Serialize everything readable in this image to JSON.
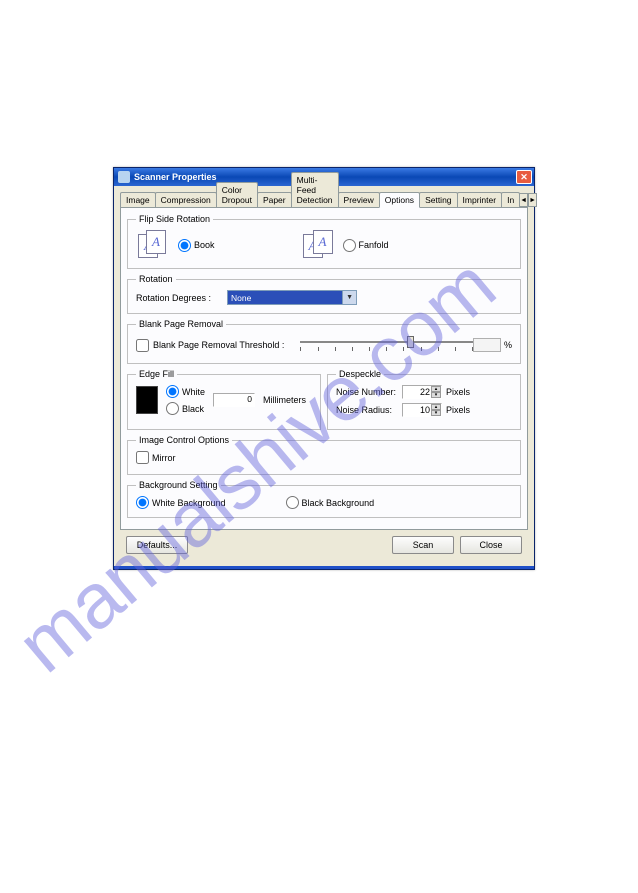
{
  "watermark": "manualshive.com",
  "window": {
    "title": "Scanner Properties"
  },
  "tabs": {
    "items": [
      "Image",
      "Compression",
      "Color Dropout",
      "Paper",
      "Multi-Feed Detection",
      "Preview",
      "Options",
      "Setting",
      "Imprinter",
      "In"
    ],
    "scroll_left": "◄",
    "scroll_right": "►"
  },
  "flip": {
    "legend": "Flip Side Rotation",
    "book": "Book",
    "fanfold": "Fanfold"
  },
  "rotation": {
    "legend": "Rotation",
    "label": "Rotation Degrees :",
    "value": "None"
  },
  "blank": {
    "legend": "Blank Page Removal",
    "label": "Blank Page Removal Threshold :",
    "value": "",
    "pct": "%"
  },
  "edgefill": {
    "legend": "Edge Fill",
    "white": "White",
    "black": "Black",
    "value": "0",
    "unit": "Millimeters"
  },
  "despeckle": {
    "legend": "Despeckle",
    "noise_number_label": "Noise Number:",
    "noise_number": "22",
    "noise_radius_label": "Noise Radius:",
    "noise_radius": "10",
    "unit": "Pixels"
  },
  "imgctrl": {
    "legend": "Image Control Options",
    "mirror": "Mirror"
  },
  "bg": {
    "legend": "Background Setting",
    "white": "White Background",
    "black": "Black Background"
  },
  "buttons": {
    "defaults": "Defaults...",
    "scan": "Scan",
    "close": "Close"
  },
  "glyph_A": "A"
}
